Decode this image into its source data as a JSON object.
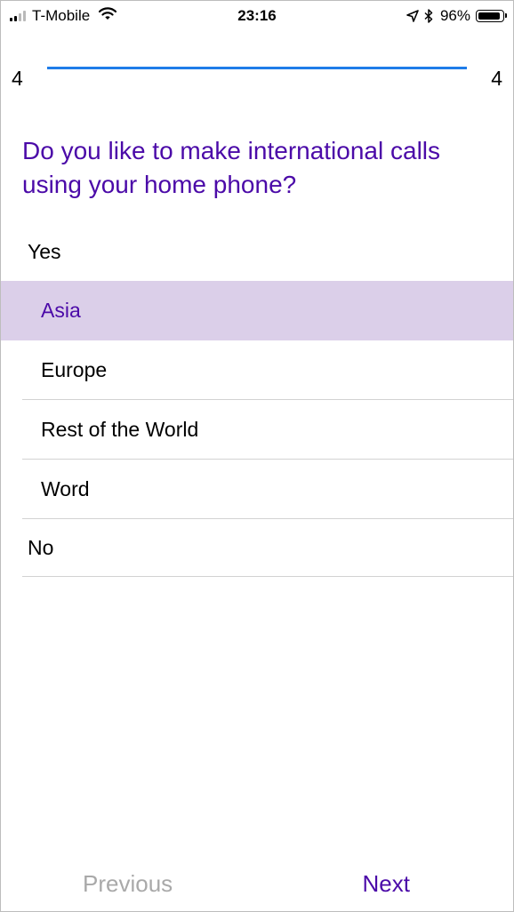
{
  "status_bar": {
    "carrier": "T-Mobile",
    "time": "23:16",
    "battery": "96%",
    "signal_bars_filled": 2,
    "signal_bars_total": 4
  },
  "progress": {
    "current": "4",
    "total": "4",
    "fraction": 1.0,
    "color": "#1e7ce8"
  },
  "question": {
    "text": "Do you like to make international calls using your home phone?",
    "color": "#4b0aa8"
  },
  "options": [
    {
      "label": "Yes",
      "level": "group",
      "selected": false
    },
    {
      "label": "Asia",
      "level": "sub",
      "selected": true
    },
    {
      "label": "Europe",
      "level": "sub",
      "selected": false
    },
    {
      "label": "Rest of the World",
      "level": "sub",
      "selected": false
    },
    {
      "label": "Word",
      "level": "sub",
      "selected": false
    },
    {
      "label": "No",
      "level": "group",
      "selected": false
    }
  ],
  "selection_color": "#dbcfe9",
  "footer": {
    "previous_label": "Previous",
    "next_label": "Next",
    "previous_enabled": false
  },
  "icons": [
    "signal-icon",
    "wifi-icon",
    "location-arrow-icon",
    "bluetooth-icon",
    "battery-icon"
  ]
}
